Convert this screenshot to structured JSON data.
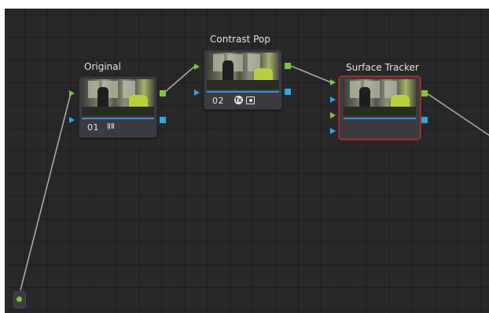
{
  "node_graph": {
    "nodes": [
      {
        "label": "Original",
        "number": "01",
        "icons": [
          "mixer-icon"
        ],
        "selected": false
      },
      {
        "label": "Contrast Pop",
        "number": "02",
        "icons": [
          "fx-icon",
          "camera-icon"
        ],
        "selected": false
      },
      {
        "label": "Surface Tracker",
        "number": "",
        "icons": [],
        "selected": true
      }
    ],
    "badges": {
      "fx": "fx"
    }
  },
  "colors": {
    "background": "#28282b",
    "node_body": "#3b3b40",
    "rgb_port": "#7fc241",
    "alpha_port": "#2aa7e8",
    "selection": "#c0302b",
    "wire": "#a9a9a9"
  }
}
